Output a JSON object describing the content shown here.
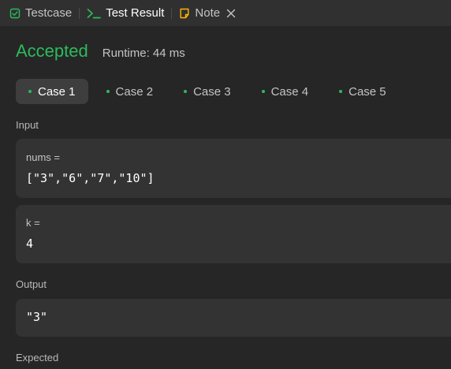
{
  "tabs": [
    {
      "label": "Testcase",
      "icon": "checkbox-icon"
    },
    {
      "label": "Test Result",
      "icon": "terminal-icon"
    },
    {
      "label": "Note",
      "icon": "note-icon"
    }
  ],
  "result": {
    "status": "Accepted",
    "runtime": "Runtime: 44 ms"
  },
  "cases": [
    "Case 1",
    "Case 2",
    "Case 3",
    "Case 4",
    "Case 5"
  ],
  "input": {
    "label": "Input",
    "params": [
      {
        "name": "nums =",
        "value": "[\"3\",\"6\",\"7\",\"10\"]"
      },
      {
        "name": "k =",
        "value": "4"
      }
    ]
  },
  "output": {
    "label": "Output",
    "value": "\"3\""
  },
  "expected": {
    "label": "Expected"
  },
  "colors": {
    "accent_green": "#2cbb5d",
    "note_icon": "#ffb800",
    "panel_bg": "#262626"
  }
}
